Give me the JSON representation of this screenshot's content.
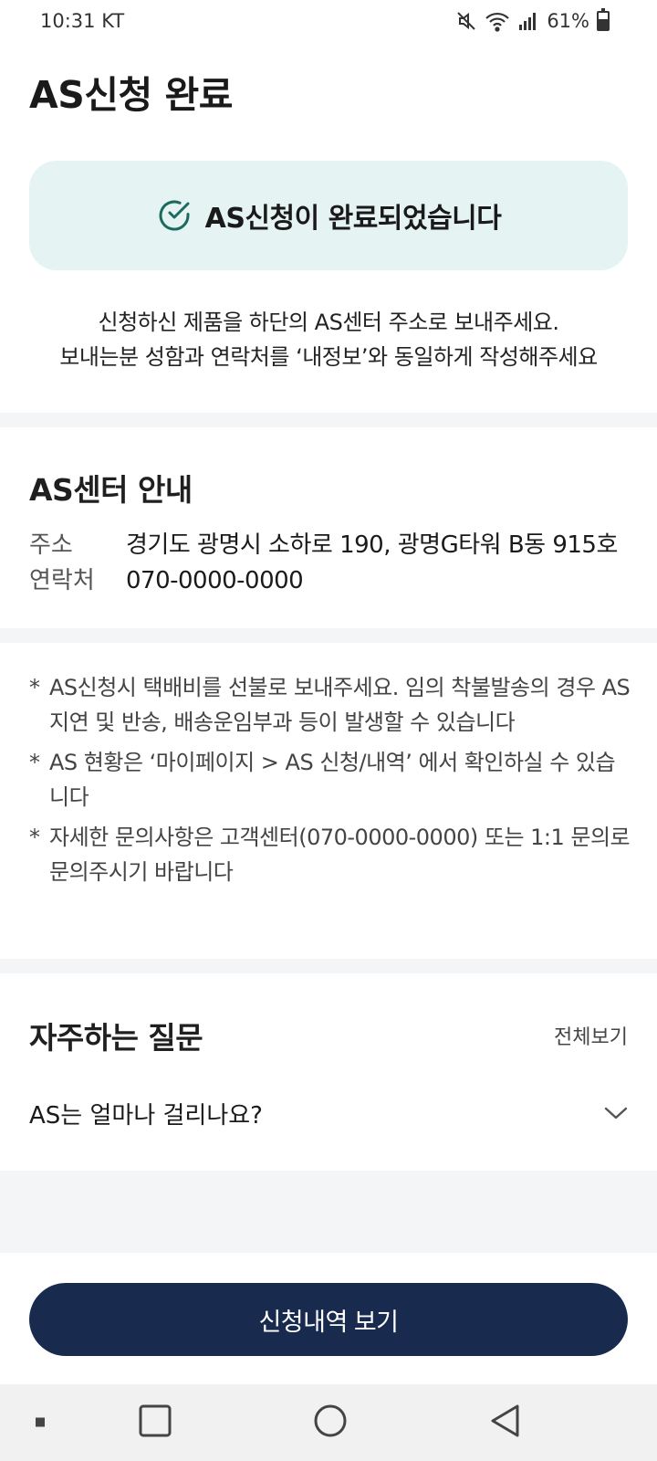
{
  "status_bar": {
    "time": "10:31 KT",
    "battery": "61%",
    "battery_level": 0.61
  },
  "page": {
    "title": "AS신청 완료"
  },
  "success": {
    "message": "AS신청이 완료되었습니다",
    "icon": "check-circle-icon",
    "color": "#1a6b5e"
  },
  "guide": {
    "line1": "신청하신 제품을 하단의 AS센터 주소로 보내주세요.",
    "line2": "보내는분 성함과 연락처를 ‘내정보’와 동일하게 작성해주세요"
  },
  "as_center": {
    "title": "AS센터 안내",
    "address_label": "주소",
    "address_value": "경기도 광명시 소하로 190, 광명G타워 B동 915호",
    "contact_label": "연락처",
    "contact_value": "070-0000-0000"
  },
  "notes": [
    {
      "mark": "*",
      "text": "AS신청시 택배비를 선불로 보내주세요. 임의 착불발송의 경우 AS지연 및 반송, 배송운임부과 등이 발생할 수 있습니다"
    },
    {
      "mark": "*",
      "text": "AS 현황은 ‘마이페이지 > AS 신청/내역’ 에서 확인하실 수 있습니다"
    },
    {
      "mark": "*",
      "text": "자세한 문의사항은 고객센터(070-0000-0000) 또는 1:1 문의로 문의주시기 바랍니다"
    }
  ],
  "faq": {
    "title": "자주하는 질문",
    "view_all": "전체보기",
    "items": [
      {
        "question": "AS는 얼마나 걸리나요?"
      }
    ]
  },
  "cta": {
    "label": "신청내역 보기",
    "color": "#182b4f"
  }
}
